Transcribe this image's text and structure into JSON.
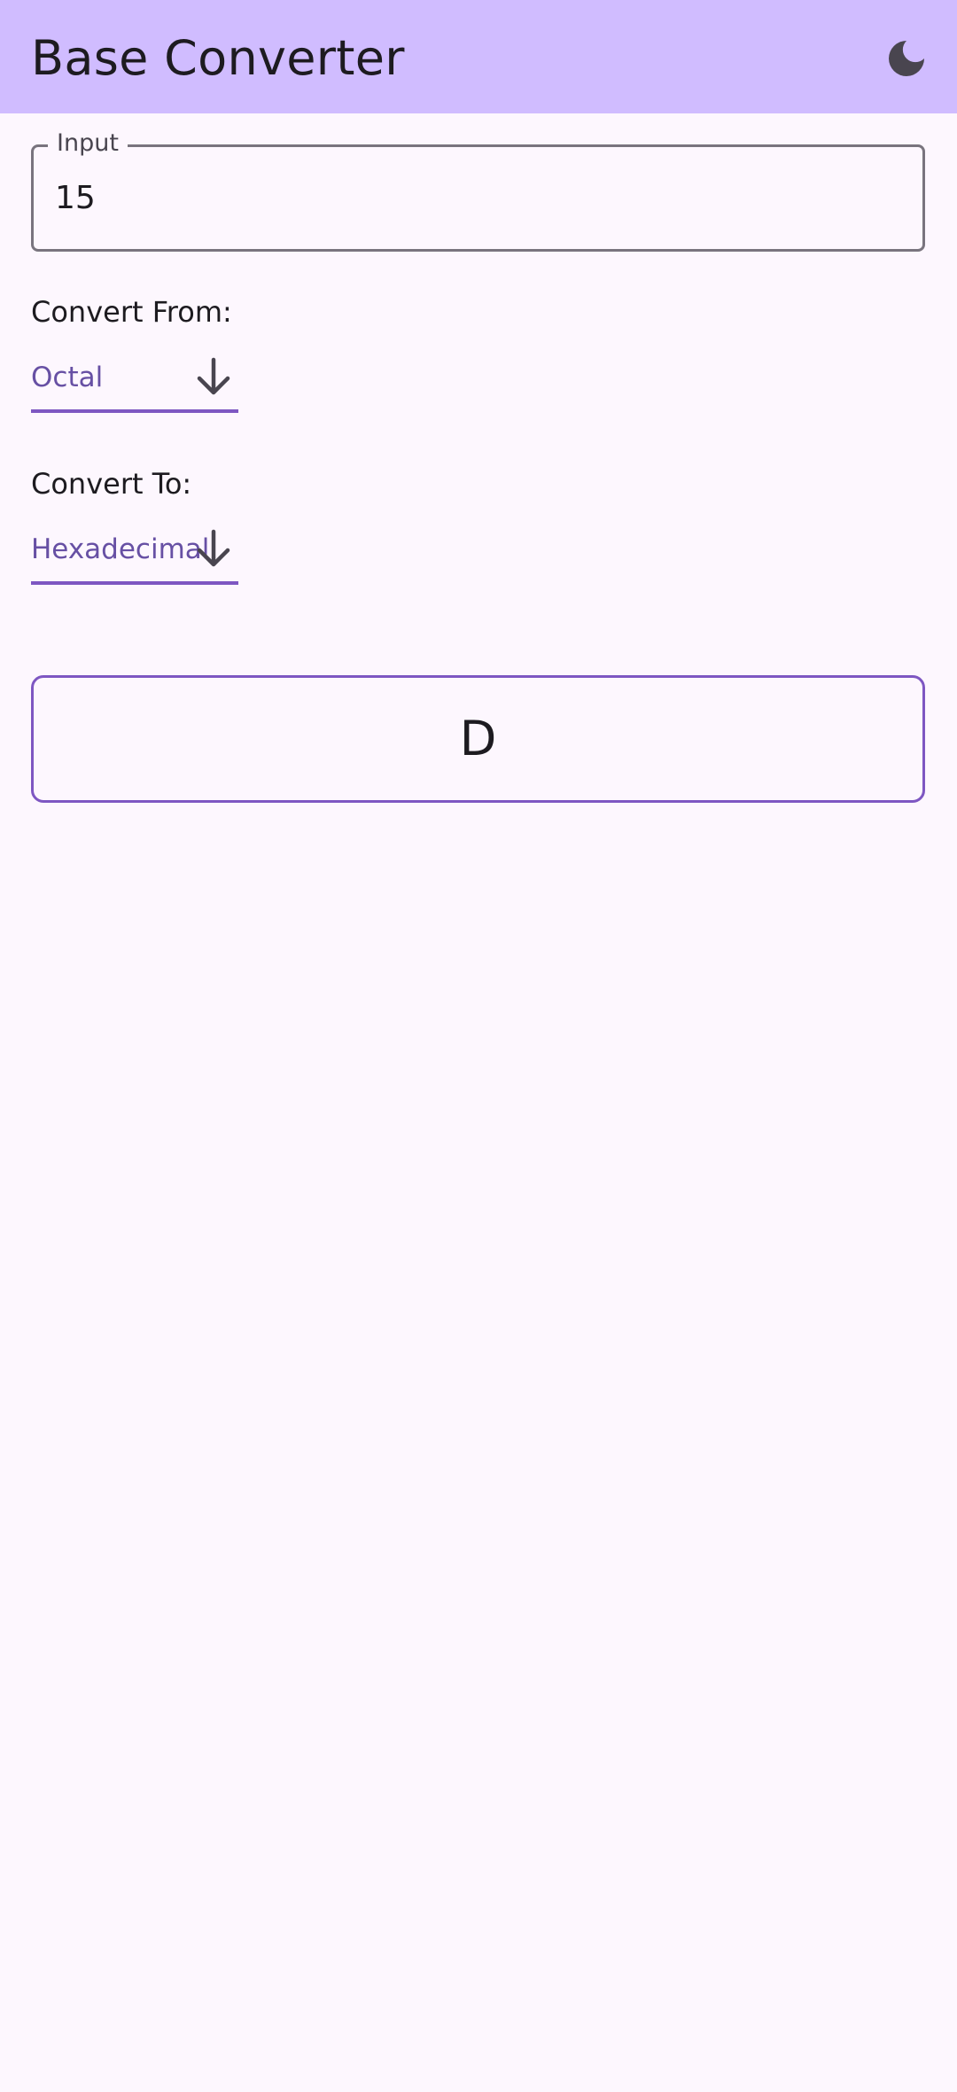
{
  "app_bar": {
    "title": "Base Converter",
    "theme_icon": "moon-icon",
    "background": "#d0bcff"
  },
  "input": {
    "label": "Input",
    "value": "15"
  },
  "convert_from": {
    "label": "Convert From:",
    "selected": "Octal",
    "icon": "arrow-down-icon"
  },
  "convert_to": {
    "label": "Convert To:",
    "selected": "Hexadecimal",
    "icon": "arrow-down-icon"
  },
  "result": {
    "value": "D"
  },
  "colors": {
    "accent": "#7e57c2",
    "accent_text": "#6750a4",
    "background": "#fdf7fe"
  }
}
